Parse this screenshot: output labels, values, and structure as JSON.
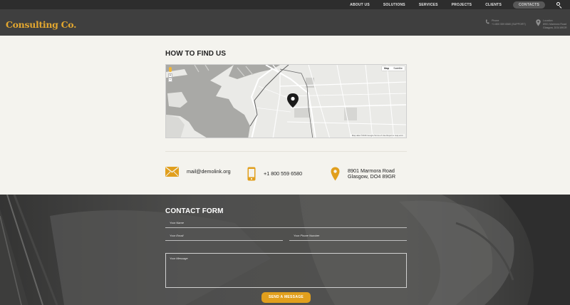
{
  "nav": {
    "items": [
      "ABOUT US",
      "SOLUTIONS",
      "SERVICES",
      "PROJECTS",
      "CLIENTS"
    ],
    "contacts": "CONTACTS"
  },
  "header": {
    "logo": "Consulting Co.",
    "phone": {
      "label": "Phone",
      "value": "+1 800 559 6580 (SUPPORT)"
    },
    "location": {
      "label": "Location",
      "line1": "8901 Marmora Road",
      "line2": "Glasgow, DO4 89GR"
    }
  },
  "find_us": {
    "title": "HOW TO FIND US",
    "map": {
      "type_map": "Map",
      "type_satellite": "Satellite",
      "zoom_in": "+",
      "zoom_out": "−",
      "attribution": "Map data ©2016 Google   Terms of Use   Report a map error"
    }
  },
  "contacts": {
    "email": "mail@demolink.org",
    "phone": "+1 800 559 6580",
    "address_line1": "8901 Marmora Road",
    "address_line2": "Glasgow, DO4 89GR"
  },
  "form": {
    "title": "CONTACT FORM",
    "name_placeholder": "Your Name",
    "email_placeholder": "Your Email",
    "phone_placeholder": "Your Phone Number",
    "message_placeholder": "Your Message",
    "submit": "SEND A MESSAGE"
  },
  "colors": {
    "accent": "#e19f1d",
    "logo": "#e3a72f",
    "topbar": "#2d2d2d",
    "header": "#3f3f3f",
    "page_bg": "#f4f3ee"
  }
}
